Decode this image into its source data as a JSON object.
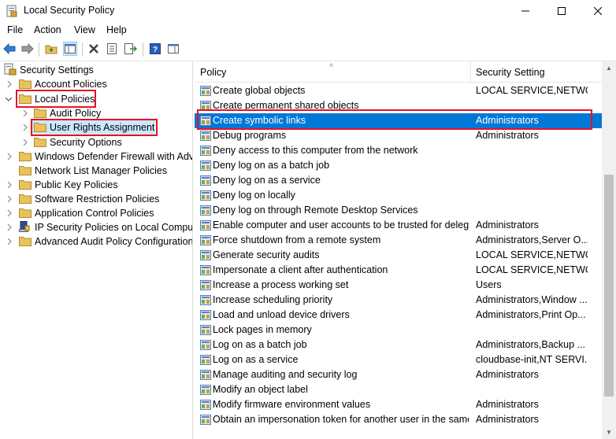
{
  "window": {
    "title": "Local Security Policy"
  },
  "menu": {
    "file": "File",
    "action": "Action",
    "view": "View",
    "help": "Help"
  },
  "tree": {
    "root": "Security Settings",
    "account_policies": "Account Policies",
    "local_policies": "Local Policies",
    "audit_policy": "Audit Policy",
    "user_rights": "User Rights Assignment",
    "security_options": "Security Options",
    "firewall": "Windows Defender Firewall with Adva",
    "network_list": "Network List Manager Policies",
    "public_key": "Public Key Policies",
    "software_restriction": "Software Restriction Policies",
    "app_control": "Application Control Policies",
    "ip_security": "IP Security Policies on Local Compute",
    "advanced_audit": "Advanced Audit Policy Configuration"
  },
  "list": {
    "col_policy": "Policy",
    "col_setting": "Security Setting",
    "rows": [
      {
        "policy": "Create global objects",
        "setting": "LOCAL SERVICE,NETWO..."
      },
      {
        "policy": "Create permanent shared objects",
        "setting": ""
      },
      {
        "policy": "Create symbolic links",
        "setting": "Administrators"
      },
      {
        "policy": "Debug programs",
        "setting": "Administrators"
      },
      {
        "policy": "Deny access to this computer from the network",
        "setting": ""
      },
      {
        "policy": "Deny log on as a batch job",
        "setting": ""
      },
      {
        "policy": "Deny log on as a service",
        "setting": ""
      },
      {
        "policy": "Deny log on locally",
        "setting": ""
      },
      {
        "policy": "Deny log on through Remote Desktop Services",
        "setting": ""
      },
      {
        "policy": "Enable computer and user accounts to be trusted for delega...",
        "setting": "Administrators"
      },
      {
        "policy": "Force shutdown from a remote system",
        "setting": "Administrators,Server O..."
      },
      {
        "policy": "Generate security audits",
        "setting": "LOCAL SERVICE,NETWO..."
      },
      {
        "policy": "Impersonate a client after authentication",
        "setting": "LOCAL SERVICE,NETWO..."
      },
      {
        "policy": "Increase a process working set",
        "setting": "Users"
      },
      {
        "policy": "Increase scheduling priority",
        "setting": "Administrators,Window ..."
      },
      {
        "policy": "Load and unload device drivers",
        "setting": "Administrators,Print Op..."
      },
      {
        "policy": "Lock pages in memory",
        "setting": ""
      },
      {
        "policy": "Log on as a batch job",
        "setting": "Administrators,Backup ..."
      },
      {
        "policy": "Log on as a service",
        "setting": "cloudbase-init,NT SERVI..."
      },
      {
        "policy": "Manage auditing and security log",
        "setting": "Administrators"
      },
      {
        "policy": "Modify an object label",
        "setting": ""
      },
      {
        "policy": "Modify firmware environment values",
        "setting": "Administrators"
      },
      {
        "policy": "Obtain an impersonation token for another user in the same...",
        "setting": "Administrators"
      }
    ]
  },
  "colors": {
    "selection": "#0078d7",
    "highlight_box": "#e81123",
    "folder": "#e8c35a"
  }
}
